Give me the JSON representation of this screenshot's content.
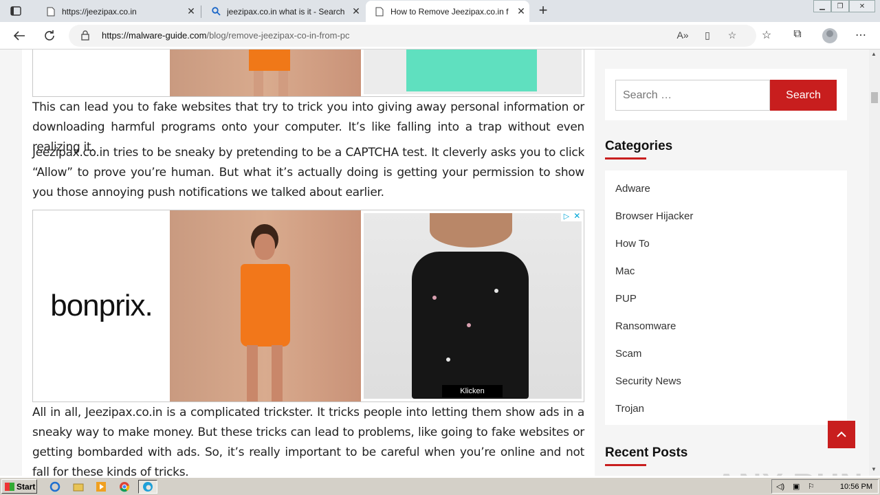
{
  "browser": {
    "tabs": [
      {
        "title": "https://jeezipax.co.in",
        "active": false
      },
      {
        "title": "jeezipax.co.in what is it - Search",
        "active": false
      },
      {
        "title": "How to Remove Jeezipax.co.in f",
        "active": true
      }
    ],
    "url_domain": "https://malware-guide.com",
    "url_path": "/blog/remove-jeezipax-co-in-from-pc"
  },
  "article": {
    "para1": "This can lead you to fake websites that try to trick you into giving away personal information or downloading harmful programs onto your computer. It’s like falling into a trap without even realizing it.",
    "para2": "Jeezipax.co.in tries to be sneaky by pretending to be a CAPTCHA test. It cleverly asks you to click “Allow” to prove you’re human. But what it’s actually doing is getting your permission to show you those annoying push notifications we talked about earlier.",
    "para3": "All in all, Jeezipax.co.in is a complicated trickster. It tricks people into letting them show ads in a sneaky way to make money. But these tricks can lead to problems, like going to fake websites or getting bombarded with ads. So, it’s really important to be careful when you’re online and not fall for these kinds of tricks."
  },
  "ad": {
    "brand": "bonprix.",
    "cta": "Klicken"
  },
  "sidebar": {
    "search_placeholder": "Search …",
    "search_button": "Search",
    "categories_heading": "Categories",
    "categories": [
      "Adware",
      "Browser Hijacker",
      "How To",
      "Mac",
      "PUP",
      "Ransomware",
      "Scam",
      "Security News",
      "Trojan"
    ],
    "recent_heading": "Recent Posts"
  },
  "watermark": "ANY RUN",
  "taskbar": {
    "start": "Start",
    "clock": "10:56 PM"
  },
  "colors": {
    "accent": "#c81e1e",
    "tabstrip": "#dfe3e8",
    "taskbar": "#d4d0c8"
  }
}
